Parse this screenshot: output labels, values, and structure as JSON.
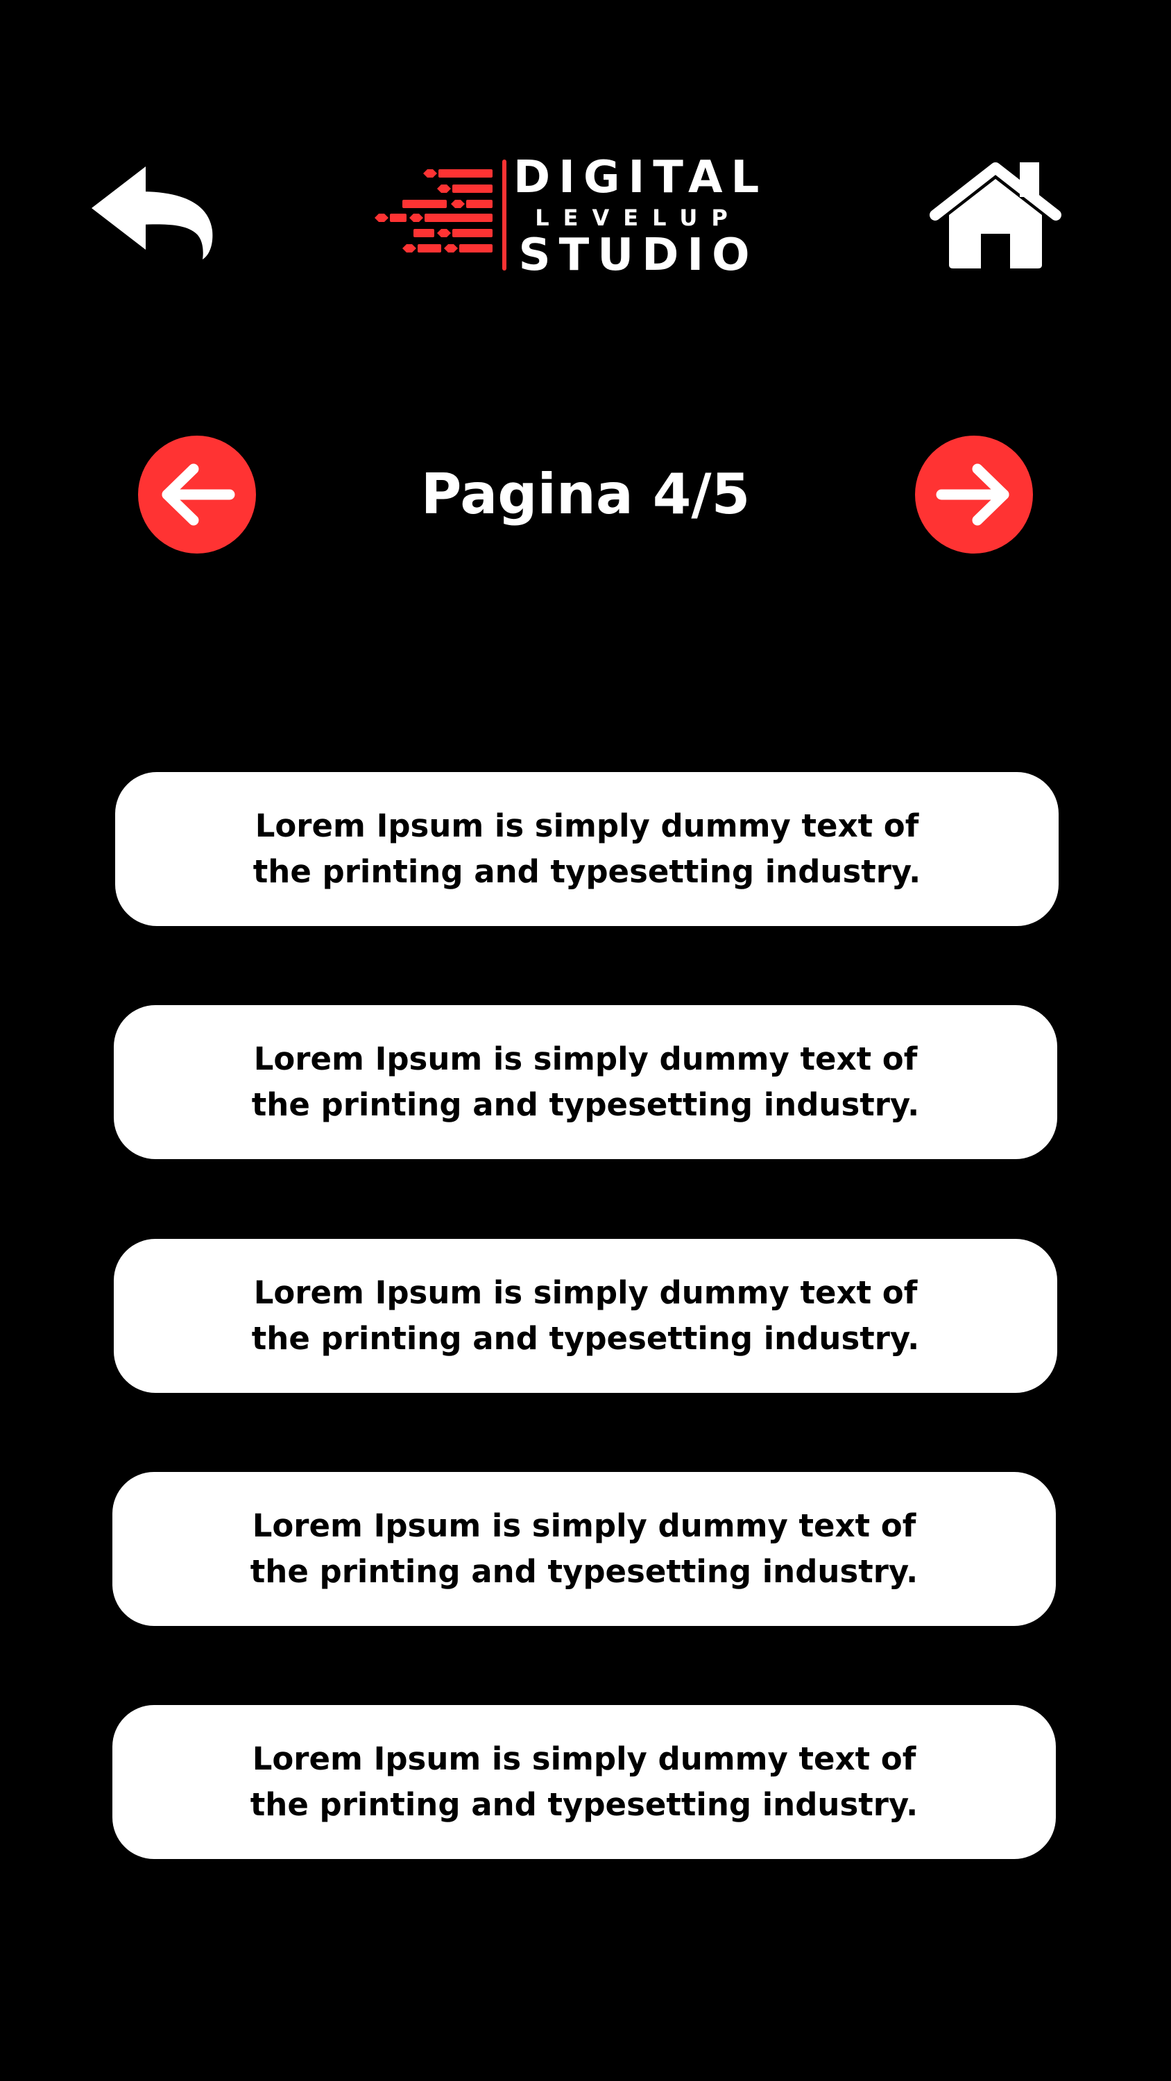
{
  "header": {
    "back_icon": "back-arrow-icon",
    "home_icon": "home-icon",
    "logo": {
      "line1": "DIGITAL",
      "line2": "LEVELUP",
      "line3": "STUDIO",
      "accent_color": "#ff3333"
    }
  },
  "pagination": {
    "label": "Pagina 4/5",
    "prev_icon": "arrow-left-icon",
    "next_icon": "arrow-right-icon",
    "accent_color": "#ff3333"
  },
  "items": [
    {
      "text": "Lorem Ipsum is simply dummy text of the printing and typesetting industry."
    },
    {
      "text": "Lorem Ipsum is simply dummy text of the printing and typesetting industry."
    },
    {
      "text": "Lorem Ipsum is simply dummy text of the printing and typesetting industry."
    },
    {
      "text": "Lorem Ipsum is simply dummy text of the printing and typesetting industry."
    },
    {
      "text": "Lorem Ipsum is simply dummy text of the printing and typesetting industry."
    }
  ],
  "colors": {
    "background": "#000000",
    "card": "#ffffff",
    "accent": "#ff3333"
  }
}
